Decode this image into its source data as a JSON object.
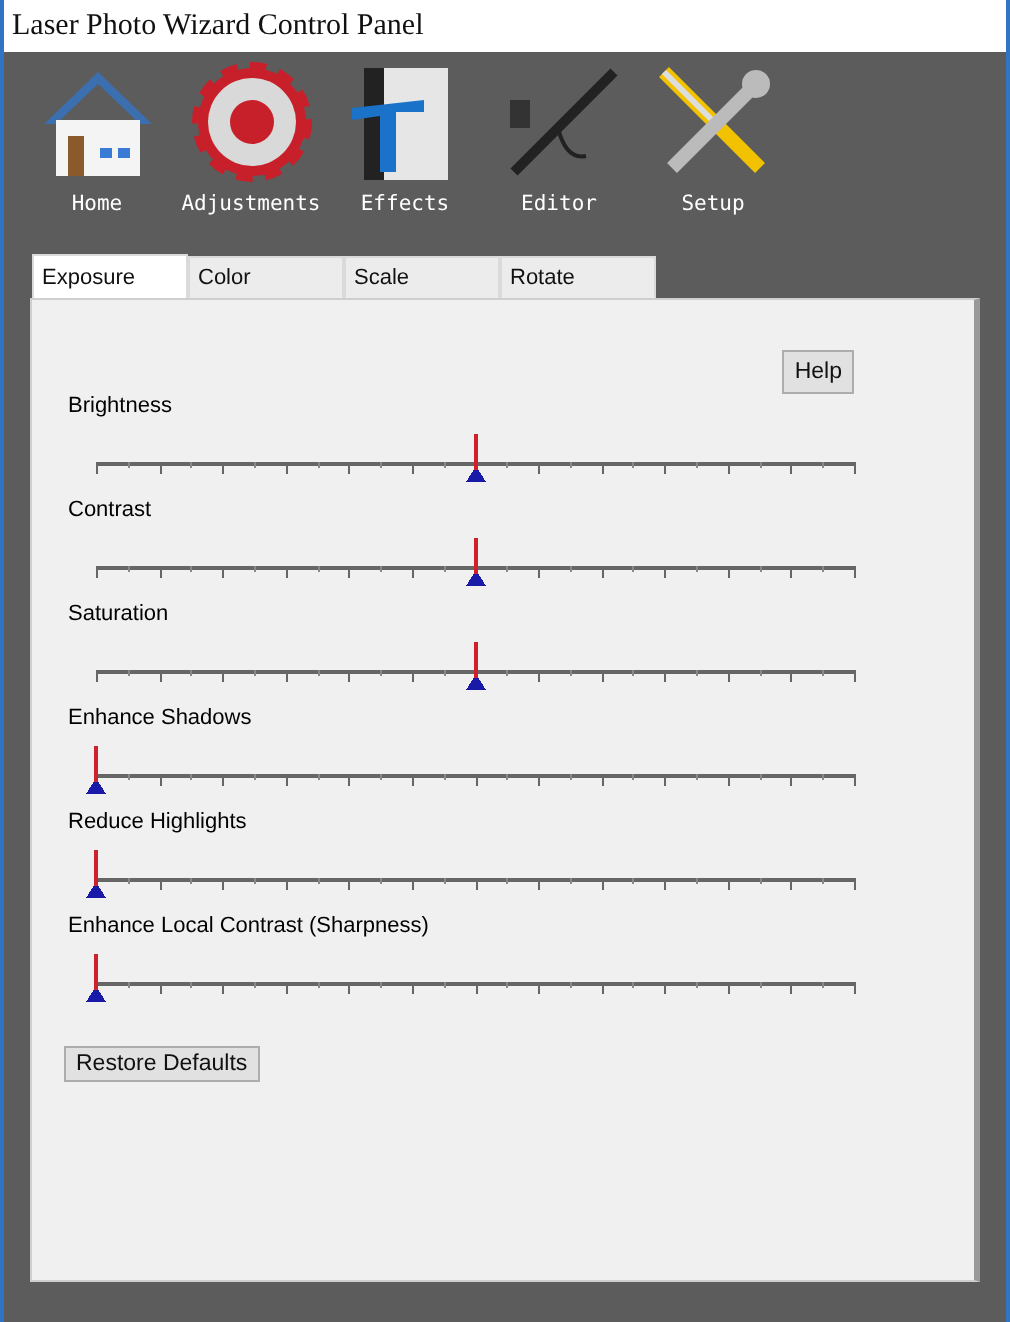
{
  "window": {
    "title": "Laser Photo Wizard Control Panel"
  },
  "toolbar": [
    {
      "kind": "home",
      "label": "Home"
    },
    {
      "kind": "gear",
      "label": "Adjustments"
    },
    {
      "kind": "effects",
      "label": "Effects"
    },
    {
      "kind": "airbrush",
      "label": "Editor"
    },
    {
      "kind": "tools",
      "label": "Setup"
    }
  ],
  "tabs": [
    {
      "label": "Exposure",
      "selected": true
    },
    {
      "label": "Color",
      "selected": false
    },
    {
      "label": "Scale",
      "selected": false
    },
    {
      "label": "Rotate",
      "selected": false
    }
  ],
  "help_button": "Help",
  "sliders": [
    {
      "name": "Brightness",
      "level": 0.5
    },
    {
      "name": "Contrast",
      "level": 0.5
    },
    {
      "name": "Saturation",
      "level": 0.5
    },
    {
      "name": "Enhance Shadows",
      "level": 0
    },
    {
      "name": "Reduce Highlights",
      "level": 0
    },
    {
      "name": "Enhance Local Contrast (Sharpness)",
      "level": 0
    }
  ],
  "restore_button": "Restore Defaults"
}
